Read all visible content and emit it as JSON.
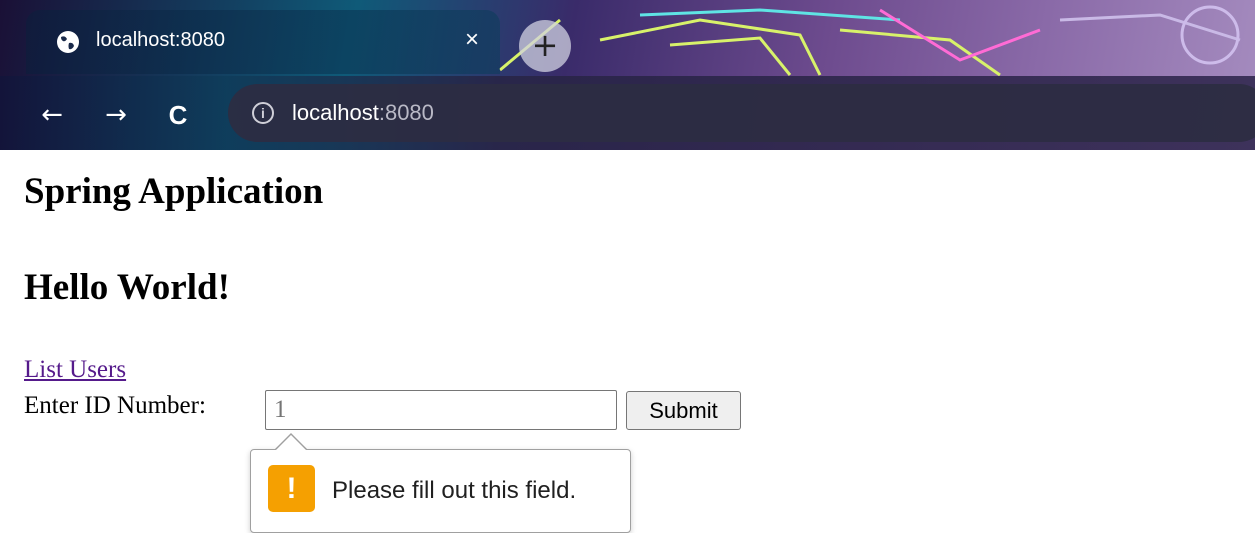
{
  "browser": {
    "tab": {
      "title": "localhost:8080",
      "favicon": "globe-icon",
      "close_label": "×"
    },
    "new_tab_label": "+",
    "nav": {
      "back_label": "←",
      "forward_label": "→",
      "reload_label": "C"
    },
    "address": {
      "info_label": "i",
      "host": "localhost",
      "port": ":8080"
    }
  },
  "page": {
    "title": "Spring Application",
    "subtitle": "Hello World!",
    "link_label": "List Users",
    "form": {
      "label": "Enter ID Number:",
      "input_placeholder": "1",
      "input_value": "",
      "submit_label": "Submit"
    },
    "validation": {
      "icon": "warning-icon",
      "icon_glyph": "!",
      "message": "Please fill out this field."
    }
  },
  "colors": {
    "link_visited": "#551a8b",
    "warning": "#f5a001"
  }
}
